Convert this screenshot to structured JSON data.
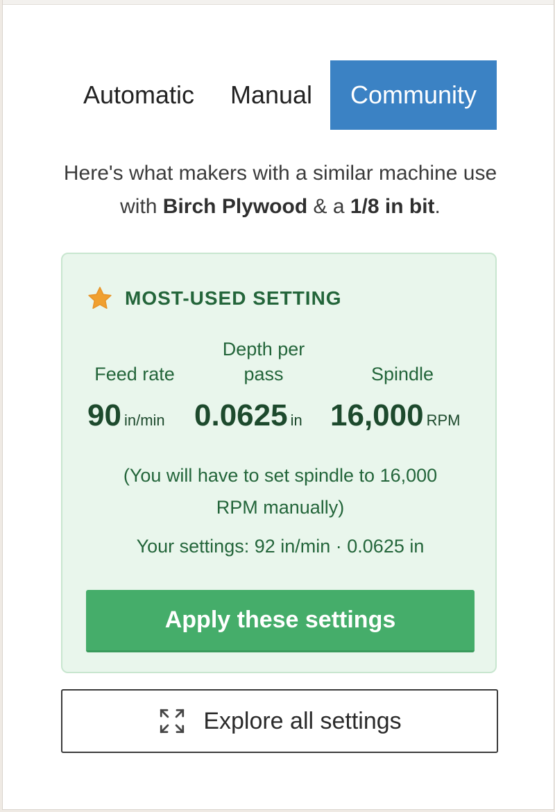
{
  "tabs": {
    "automatic": "Automatic",
    "manual": "Manual",
    "community": "Community",
    "active": "Community"
  },
  "intro": {
    "prefix": "Here's what makers with a similar machine use with ",
    "material": "Birch Plywood",
    "joiner": " & a ",
    "bit": "1/8 in bit",
    "suffix": "."
  },
  "card": {
    "icon": "star-icon",
    "title": "MOST-USED SETTING",
    "metrics": {
      "feed": {
        "label": "Feed rate",
        "value": "90",
        "unit": "in/min"
      },
      "depth": {
        "label": "Depth per pass",
        "value": "0.0625",
        "unit": "in"
      },
      "spindle": {
        "label": "Spindle",
        "value": "16,000",
        "unit": "RPM"
      }
    },
    "note": "(You will have to set spindle to 16,000 RPM manually)",
    "your_settings": "Your settings: 92 in/min · 0.0625 in",
    "apply_label": "Apply these settings"
  },
  "explore": {
    "icon": "expand-icon",
    "label": "Explore all settings"
  },
  "colors": {
    "tab_active_bg": "#3b82c4",
    "card_bg": "#e9f6ec",
    "accent_green": "#45ad6a",
    "text_green": "#23653a",
    "star": "#f0a030"
  }
}
